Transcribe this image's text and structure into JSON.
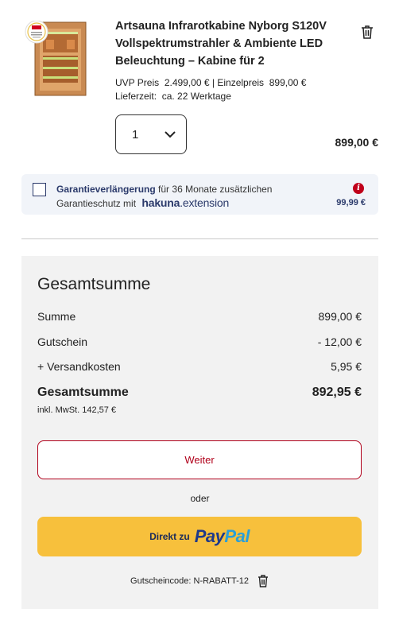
{
  "product": {
    "title": "Artsauna Infrarotkabine Nyborg S120V Vollspektrumstrahler & Ambiente LED Beleuchtung – Kabine für 2",
    "uvp_label": "UVP Preis",
    "uvp_value": "2.499,00 €",
    "separator": "|",
    "unit_label": "Einzelpreis",
    "unit_value": "899,00 €",
    "delivery_label": "Lieferzeit:",
    "delivery_value": "ca. 22 Werktage",
    "quantity": "1",
    "line_price": "899,00 €",
    "image_icon": "infrared-sauna-cabin-image",
    "delete_icon": "trash-icon"
  },
  "warranty": {
    "bold_text": "Garantieverlängerung",
    "text1": " für 36 Monate zusätzlichen",
    "text2": "Garantieschutz mit",
    "brand_a": "hakuna",
    "brand_b": ".extension",
    "price": "99,99 €",
    "info_glyph": "i"
  },
  "summary": {
    "heading": "Gesamtsumme",
    "rows": [
      {
        "label": "Summe",
        "value": "899,00 €"
      },
      {
        "label": "Gutschein",
        "value": "- 12,00 €"
      },
      {
        "label": "+ Versandkosten",
        "value": "5,95 €"
      }
    ],
    "total_label": "Gesamtsumme",
    "total_value": "892,95 €",
    "vat": "inkl. MwSt. 142,57 €",
    "continue_button": "Weiter",
    "or_text": "oder",
    "paypal_prefix": "Direkt zu",
    "paypal_a": "Pay",
    "paypal_b": "Pal",
    "voucher_text": "Gutscheincode: N-RABATT-12"
  },
  "colors": {
    "brand_red": "#b0001a",
    "paypal_yellow": "#f7c03c",
    "paypal_dark_blue": "#1f3a8a",
    "paypal_light_blue": "#2a9fd8",
    "navy": "#2b3a6b"
  }
}
